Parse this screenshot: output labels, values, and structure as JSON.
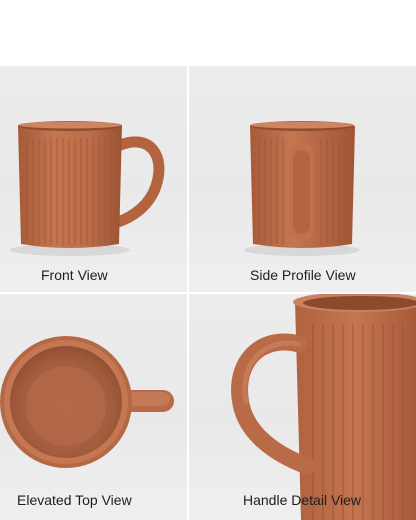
{
  "panels": [
    {
      "caption": "Front View"
    },
    {
      "caption": "Side Profile View"
    },
    {
      "caption": "Elevated Top View"
    },
    {
      "caption": "Handle Detail View"
    }
  ],
  "colors": {
    "mug": "#bd6e4a",
    "mug_dark": "#9b5434",
    "mug_light": "#cf8560",
    "background": "#ebebeb"
  }
}
